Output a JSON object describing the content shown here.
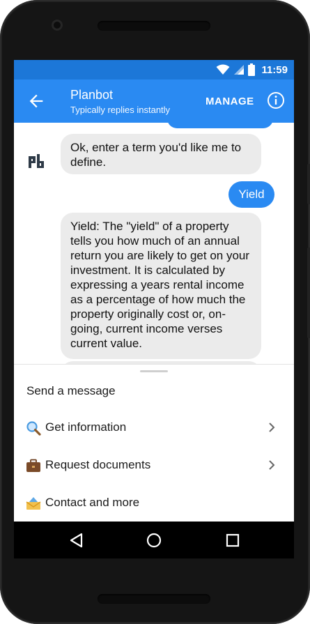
{
  "status_bar": {
    "time": "11:59",
    "icons": [
      "wifi-icon",
      "cell-signal-icon",
      "battery-icon"
    ]
  },
  "app_bar": {
    "title": "Planbot",
    "subtitle": "Typically replies instantly",
    "manage_label": "MANAGE",
    "icons": [
      "back-arrow-icon",
      "info-icon"
    ]
  },
  "chat": {
    "messages": [
      {
        "sender": "bot",
        "text": "Ok, enter a term you'd like me to define."
      },
      {
        "sender": "user",
        "text": "Yield"
      },
      {
        "sender": "bot",
        "text": "Yield: The \"yield\" of a property tells you how much of an annual return you are likely to get on your investment. It is calculated by expressing a years rental income as a percentage of how much the property originally cost or, on-going, current income verses current value."
      }
    ]
  },
  "composer": {
    "label": "Send a message",
    "menu": [
      {
        "icon": "magnifying-glass-icon",
        "label": "Get information"
      },
      {
        "icon": "briefcase-icon",
        "label": "Request documents"
      },
      {
        "icon": "envelope-icon",
        "label": "Contact and more"
      }
    ]
  },
  "colors": {
    "status_bar": "#1c77d8",
    "app_bar": "#2a8af2",
    "bot_bubble": "#ebebeb",
    "user_bubble": "#2a8af2"
  }
}
